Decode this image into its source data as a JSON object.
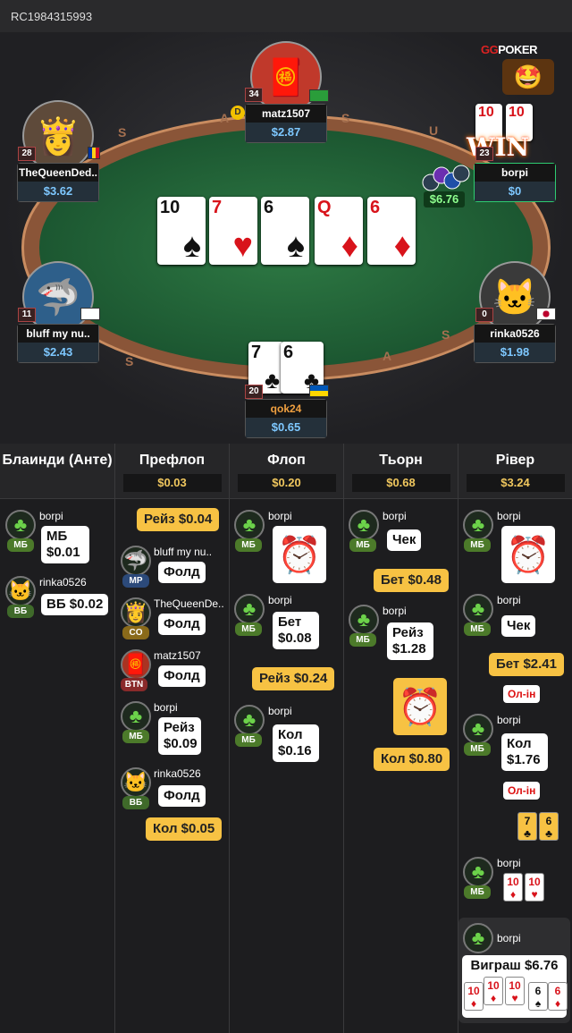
{
  "hand_id": "RC1984315993",
  "logo": {
    "gg": "GG",
    "text": "POKER"
  },
  "table_rail_text": [
    "S",
    "A",
    "S",
    "U",
    "S",
    "A",
    "S"
  ],
  "emoji": "🤩",
  "players": [
    {
      "name": "matz1507",
      "stack": "$2.87",
      "level": "34",
      "flag": "brazil",
      "avatar": "🧧"
    },
    {
      "name": "TheQueenDed..",
      "stack": "$3.62",
      "level": "28",
      "flag": "romania",
      "avatar": "👸"
    },
    {
      "name": "borpi",
      "stack": "$0",
      "level": "23",
      "avatar": "🍀"
    },
    {
      "name": "bluff my nu..",
      "stack": "$2.43",
      "level": "11",
      "flag": "georgia",
      "avatar": "🦈"
    },
    {
      "name": "rinka0526",
      "stack": "$1.98",
      "level": "0",
      "flag": "japan",
      "avatar": "🐱"
    },
    {
      "name": "qok24",
      "stack": "$0.65",
      "level": "20",
      "flag": "ukraine"
    }
  ],
  "dealer_label": "D",
  "win_label": "WIN",
  "pot_amount": "$6.76",
  "board": [
    {
      "rank": "10",
      "suit": "♠",
      "color": "blk"
    },
    {
      "rank": "7",
      "suit": "♥",
      "color": "red"
    },
    {
      "rank": "6",
      "suit": "♠",
      "color": "blk"
    },
    {
      "rank": "Q",
      "suit": "♦",
      "color": "red"
    },
    {
      "rank": "6",
      "suit": "♦",
      "color": "red"
    }
  ],
  "hero_cards": [
    {
      "rank": "7",
      "suit": "♣"
    },
    {
      "rank": "6",
      "suit": "♣"
    }
  ],
  "winner_cards": [
    {
      "rank": "10",
      "suit": "♦"
    },
    {
      "rank": "10",
      "suit": "♥"
    }
  ],
  "history": {
    "columns": [
      {
        "title": "Блаинди (Анте)",
        "pot": ""
      },
      {
        "title": "Префлоп",
        "pot": "$0.03"
      },
      {
        "title": "Флоп",
        "pot": "$0.20"
      },
      {
        "title": "Тьорн",
        "pot": "$0.68"
      },
      {
        "title": "Рівер",
        "pot": "$3.24"
      }
    ],
    "blinds": [
      {
        "name": "borpi",
        "pos": "МБ",
        "action": "МБ $0.01"
      },
      {
        "name": "rinka0526",
        "pos": "ВБ",
        "action": "ВБ $0.02"
      }
    ],
    "preflop": {
      "hero_raise": "Рейз $0.04",
      "rows": [
        {
          "name": "bluff my nu..",
          "pos": "MP",
          "action": "Фолд"
        },
        {
          "name": "TheQueenDe..",
          "pos": "CO",
          "action": "Фолд"
        },
        {
          "name": "matz1507",
          "pos": "BTN",
          "action": "Фолд"
        },
        {
          "name": "borpi",
          "pos": "МБ",
          "action": "Рейз $0.09"
        },
        {
          "name": "rinka0526",
          "pos": "ВБ",
          "action": "Фолд"
        }
      ],
      "hero_call": "Кол $0.05"
    },
    "flop": {
      "rows": [
        {
          "name": "borpi",
          "pos": "МБ"
        },
        {
          "name": "borpi",
          "pos": "МБ",
          "action": "Бет $0.08"
        },
        {
          "name": "borpi",
          "pos": "МБ",
          "action": "Кол $0.16"
        }
      ],
      "hero_raise": "Рейз $0.24"
    },
    "turn": {
      "rows": [
        {
          "name": "borpi",
          "pos": "МБ",
          "action": "Чек"
        },
        {
          "name": "borpi",
          "pos": "МБ",
          "action": "Рейз $1.28"
        }
      ],
      "hero_bet": "Бет $0.48",
      "hero_call": "Кол $0.80"
    },
    "river": {
      "rows": [
        {
          "name": "borpi",
          "pos": "МБ"
        },
        {
          "name": "borpi",
          "pos": "МБ",
          "action": "Чек"
        },
        {
          "name": "borpi",
          "pos": "МБ",
          "action": "Кол $1.76"
        },
        {
          "name": "borpi",
          "pos": "МБ"
        }
      ],
      "hero_bet": "Бет $2.41",
      "allin1": "Ол-ін",
      "allin2": "Ол-ін",
      "win_name": "borpi",
      "win_text": "Виграш $6.76",
      "win_cards": [
        {
          "r": "10",
          "c": "red"
        },
        {
          "r": "10",
          "c": "red"
        },
        {
          "r": "10",
          "c": "red"
        },
        {
          "r": "6",
          "c": "blk"
        },
        {
          "r": "6",
          "c": "red"
        }
      ]
    }
  }
}
